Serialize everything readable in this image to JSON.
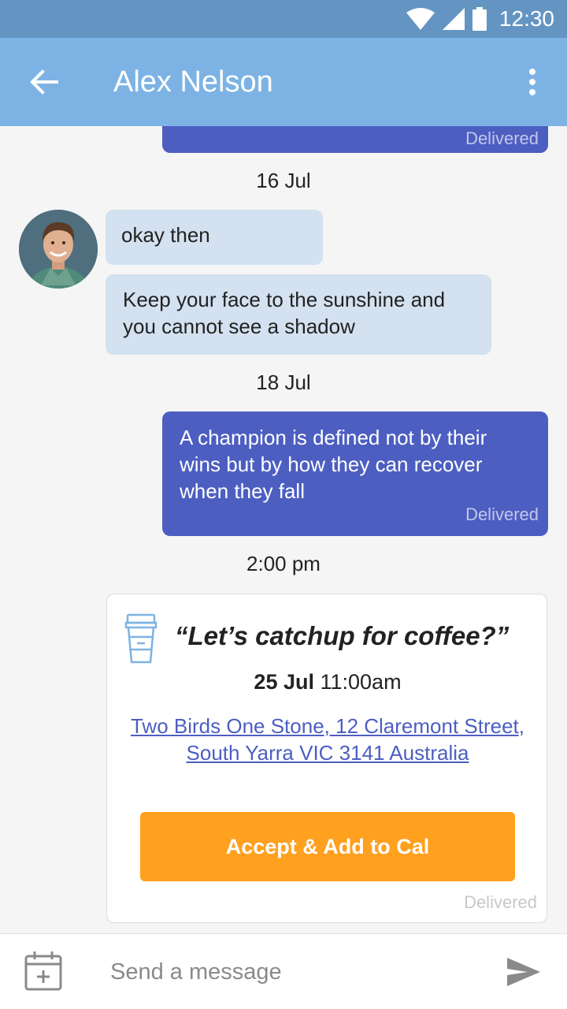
{
  "status_bar": {
    "time": "12:30"
  },
  "header": {
    "contact_name": "Alex Nelson"
  },
  "messages": {
    "top_delivered": "Delivered",
    "date_1": "16 Jul",
    "in_1": "okay then",
    "in_2": "Keep your face to the sunshine and you cannot see a shadow",
    "date_2": "18 Jul",
    "out_1": "A champion is defined not by their wins but by how they can recover when they fall",
    "out_1_status": "Delivered",
    "time_3": "2:00 pm"
  },
  "invite": {
    "title": "“Let’s catchup for coffee?”",
    "date": "25 Jul",
    "time": "11:00am",
    "address": "Two Birds One Stone, 12 Claremont Street, South Yarra VIC 3141 Australia",
    "accept_label": "Accept & Add to Cal",
    "status": "Delivered"
  },
  "composer": {
    "placeholder": "Send a message"
  },
  "colors": {
    "status_bar": "#6495c2",
    "app_bar": "#7db3e4",
    "outgoing_bubble": "#4d5ec1",
    "incoming_bubble": "#d3e1f0",
    "accept_button": "#ffa01e"
  },
  "icons": [
    "wifi-icon",
    "signal-icon",
    "battery-icon",
    "back-arrow-icon",
    "more-vert-icon",
    "coffee-cup-icon",
    "calendar-add-icon",
    "send-icon"
  ]
}
